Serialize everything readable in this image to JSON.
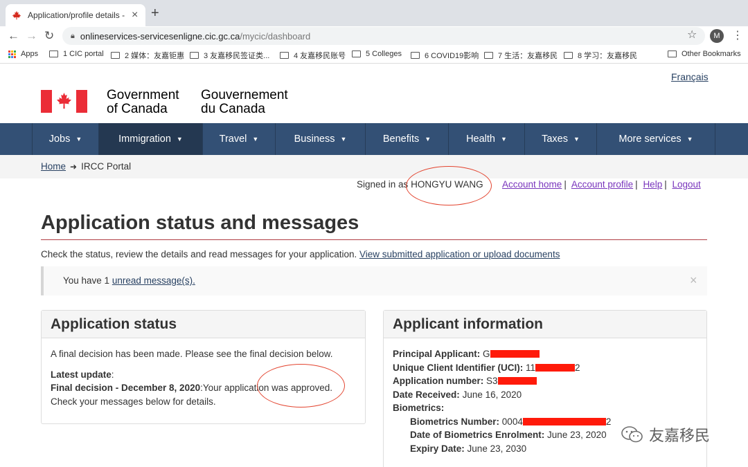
{
  "browser": {
    "tab_title": "Application/profile details - Imm",
    "new_tab": "+",
    "url_host": "onlineservices-servicesenligne.cic.gc.ca",
    "url_path": "/mycic/dashboard",
    "profile_initial": "M",
    "bookmarks": [
      {
        "label": "Apps",
        "icon": "apps-grid-icon"
      },
      {
        "label": "1 CIC portal",
        "icon": "folder-icon"
      },
      {
        "label": "2 媒体：友嘉钜惠",
        "icon": "folder-icon"
      },
      {
        "label": "3 友嘉移民签证类...",
        "icon": "folder-icon"
      },
      {
        "label": "4 友嘉移民账号",
        "icon": "folder-icon"
      },
      {
        "label": "5 Colleges",
        "icon": "folder-icon"
      },
      {
        "label": "6 COVID19影响",
        "icon": "folder-icon"
      },
      {
        "label": "7 生活：友嘉移民",
        "icon": "folder-icon"
      },
      {
        "label": "8 学习：友嘉移民",
        "icon": "folder-icon"
      },
      {
        "label": "Other Bookmarks",
        "icon": "folder-icon"
      }
    ]
  },
  "header": {
    "language_toggle": "Français",
    "gov_en_line1": "Government",
    "gov_en_line2": "of Canada",
    "gov_fr_line1": "Gouvernement",
    "gov_fr_line2": "du Canada",
    "flag_color": "#eb2d37"
  },
  "nav": {
    "items": [
      {
        "label": "Jobs"
      },
      {
        "label": "Immigration",
        "active": true
      },
      {
        "label": "Travel"
      },
      {
        "label": "Business"
      },
      {
        "label": "Benefits"
      },
      {
        "label": "Health"
      },
      {
        "label": "Taxes"
      },
      {
        "label": "More services"
      }
    ]
  },
  "breadcrumb": {
    "home": "Home",
    "current": "IRCC Portal"
  },
  "account": {
    "signed_in_prefix": "Signed in as",
    "user_name": "HONGYU WANG",
    "links": [
      "Account home",
      "Account profile",
      "Help",
      "Logout"
    ],
    "separator": "|"
  },
  "main": {
    "title": "Application status and messages",
    "intro_text": "Check the status, review the details and read messages for your application.",
    "intro_link": "View submitted application or upload documents",
    "alert_prefix": "You have 1",
    "alert_link": "unread message(s).",
    "alert_close": "×"
  },
  "status_panel": {
    "heading": "Application status",
    "line1": "A final decision has been made. Please see the final decision below.",
    "latest_label": "Latest update",
    "latest_colon": ":",
    "final_label": "Final decision - December 8, 2020",
    "final_text": ":Your application was approved.",
    "line4": "Check your messages below for details."
  },
  "applicant_panel": {
    "heading": "Applicant information",
    "principal_label": "Principal Applicant:",
    "principal_value": "G",
    "uci_label": "Unique Client Identifier (UCI):",
    "uci_value_start": "11",
    "uci_value_end": "2",
    "appnum_label": "Application number:",
    "appnum_value": "S3",
    "received_label": "Date Received:",
    "received_value": "June 16, 2020",
    "biometrics_label": "Biometrics:",
    "bio_number_label": "Biometrics Number:",
    "bio_number_start": "0004",
    "bio_number_end": "2",
    "bio_enrol_label": "Date of Biometrics Enrolment:",
    "bio_enrol_value": "June 23, 2020",
    "expiry_label": "Expiry Date:",
    "expiry_value": "June 23, 2030"
  },
  "watermark": {
    "text": "友嘉移民"
  },
  "colors": {
    "nav_bg": "#335075",
    "nav_active": "#243851",
    "link": "#284162",
    "visited_link": "#7834bc",
    "title_rule": "#af3c43",
    "annotation_red": "#e3442f",
    "redaction": "#ff1a0a"
  }
}
